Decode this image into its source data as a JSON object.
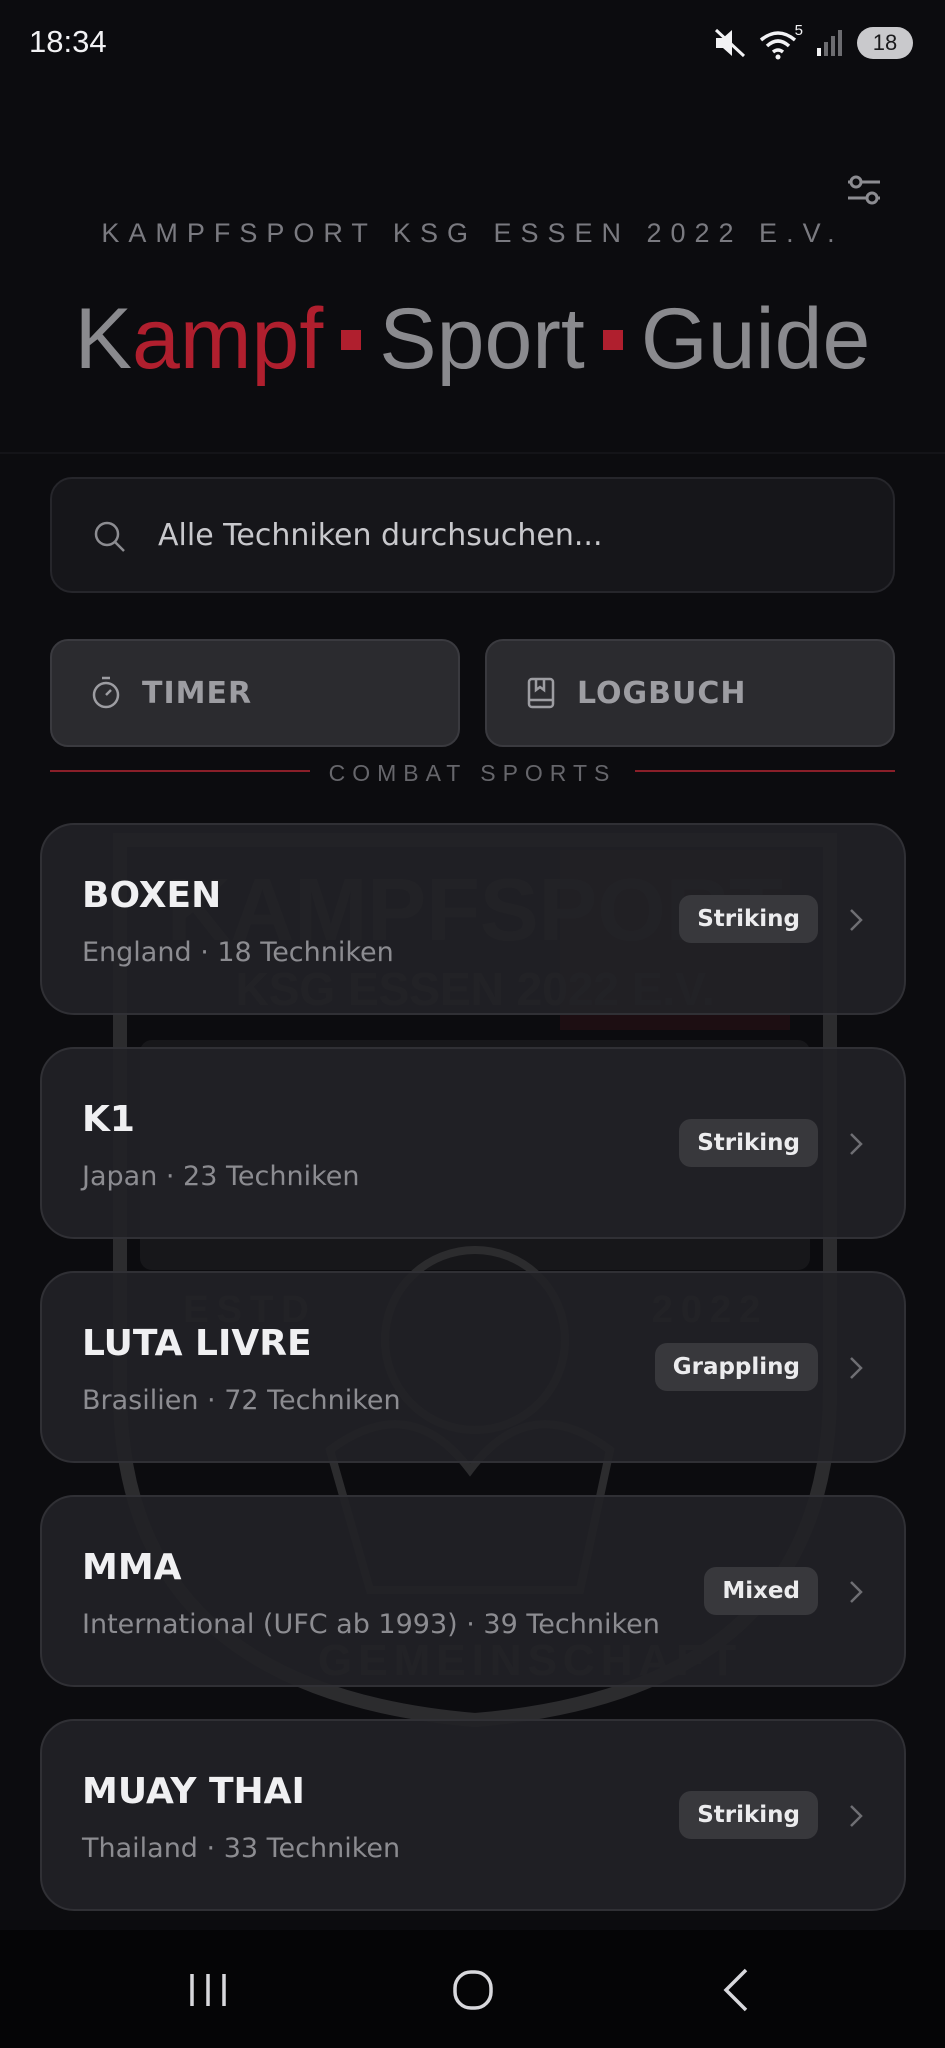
{
  "status_bar": {
    "time": "18:34",
    "icons": [
      "mute-icon",
      "wifi-icon",
      "signal-icon"
    ],
    "wifi_label": "5",
    "battery": "18"
  },
  "header": {
    "club_name": "KAMPFSPORT KSG ESSEN 2022 E.V.",
    "title_parts": [
      "K",
      "ampf",
      "Sport",
      "Guide"
    ],
    "settings_icon": "sliders-icon"
  },
  "search": {
    "placeholder": "Alle Techniken durchsuchen..."
  },
  "actions": {
    "timer_label": "TIMER",
    "logbuch_label": "LOGBUCH"
  },
  "section": {
    "title": "COMBAT SPORTS"
  },
  "sports": [
    {
      "name": "BOXEN",
      "meta": "England · 18 Techniken",
      "badge": "Striking"
    },
    {
      "name": "K1",
      "meta": "Japan · 23 Techniken",
      "badge": "Striking"
    },
    {
      "name": "LUTA LIVRE",
      "meta": "Brasilien · 72 Techniken",
      "badge": "Grappling"
    },
    {
      "name": "MMA",
      "meta": "International (UFC ab 1993) · 39 Techniken",
      "badge": "Mixed"
    },
    {
      "name": "MUAY THAI",
      "meta": "Thailand · 33 Techniken",
      "badge": "Striking"
    }
  ],
  "watermark": {
    "line1": "KAMPFSPORT",
    "line2": "KSG ESSEN 2022 E.V.",
    "estd": "ESTD",
    "year": "2022",
    "arc": "GEMEINSCHAFT"
  },
  "colors": {
    "accent": "#b01f2e",
    "background": "#0c0c0f",
    "card": "#222226"
  }
}
